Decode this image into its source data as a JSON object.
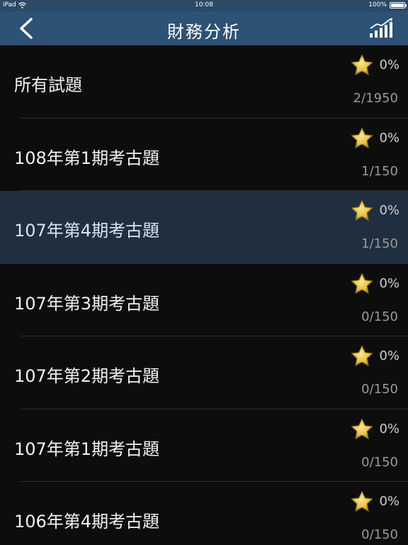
{
  "statusbar": {
    "device": "iPad",
    "time": "10:08",
    "battery": "100%"
  },
  "navbar": {
    "title": "財務分析"
  },
  "rows": [
    {
      "label": "所有試題",
      "percent": "0%",
      "count": "2/1950",
      "selected": false
    },
    {
      "label": "108年第1期考古題",
      "percent": "0%",
      "count": "1/150",
      "selected": false
    },
    {
      "label": "107年第4期考古題",
      "percent": "0%",
      "count": "1/150",
      "selected": true
    },
    {
      "label": "107年第3期考古題",
      "percent": "0%",
      "count": "0/150",
      "selected": false
    },
    {
      "label": "107年第2期考古題",
      "percent": "0%",
      "count": "0/150",
      "selected": false
    },
    {
      "label": "107年第1期考古題",
      "percent": "0%",
      "count": "0/150",
      "selected": false
    },
    {
      "label": "106年第4期考古題",
      "percent": "0%",
      "count": "0/150",
      "selected": false
    }
  ]
}
